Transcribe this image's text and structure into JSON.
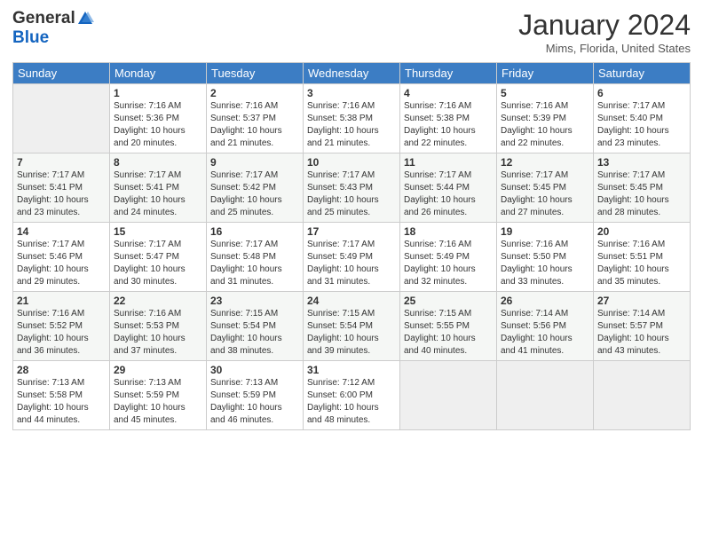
{
  "header": {
    "logo_general": "General",
    "logo_blue": "Blue",
    "month_title": "January 2024",
    "location": "Mims, Florida, United States"
  },
  "weekdays": [
    "Sunday",
    "Monday",
    "Tuesday",
    "Wednesday",
    "Thursday",
    "Friday",
    "Saturday"
  ],
  "weeks": [
    [
      {
        "day": "",
        "empty": true
      },
      {
        "day": "1",
        "sunrise": "Sunrise: 7:16 AM",
        "sunset": "Sunset: 5:36 PM",
        "daylight": "Daylight: 10 hours and 20 minutes."
      },
      {
        "day": "2",
        "sunrise": "Sunrise: 7:16 AM",
        "sunset": "Sunset: 5:37 PM",
        "daylight": "Daylight: 10 hours and 21 minutes."
      },
      {
        "day": "3",
        "sunrise": "Sunrise: 7:16 AM",
        "sunset": "Sunset: 5:38 PM",
        "daylight": "Daylight: 10 hours and 21 minutes."
      },
      {
        "day": "4",
        "sunrise": "Sunrise: 7:16 AM",
        "sunset": "Sunset: 5:38 PM",
        "daylight": "Daylight: 10 hours and 22 minutes."
      },
      {
        "day": "5",
        "sunrise": "Sunrise: 7:16 AM",
        "sunset": "Sunset: 5:39 PM",
        "daylight": "Daylight: 10 hours and 22 minutes."
      },
      {
        "day": "6",
        "sunrise": "Sunrise: 7:17 AM",
        "sunset": "Sunset: 5:40 PM",
        "daylight": "Daylight: 10 hours and 23 minutes."
      }
    ],
    [
      {
        "day": "7",
        "sunrise": "Sunrise: 7:17 AM",
        "sunset": "Sunset: 5:41 PM",
        "daylight": "Daylight: 10 hours and 23 minutes."
      },
      {
        "day": "8",
        "sunrise": "Sunrise: 7:17 AM",
        "sunset": "Sunset: 5:41 PM",
        "daylight": "Daylight: 10 hours and 24 minutes."
      },
      {
        "day": "9",
        "sunrise": "Sunrise: 7:17 AM",
        "sunset": "Sunset: 5:42 PM",
        "daylight": "Daylight: 10 hours and 25 minutes."
      },
      {
        "day": "10",
        "sunrise": "Sunrise: 7:17 AM",
        "sunset": "Sunset: 5:43 PM",
        "daylight": "Daylight: 10 hours and 25 minutes."
      },
      {
        "day": "11",
        "sunrise": "Sunrise: 7:17 AM",
        "sunset": "Sunset: 5:44 PM",
        "daylight": "Daylight: 10 hours and 26 minutes."
      },
      {
        "day": "12",
        "sunrise": "Sunrise: 7:17 AM",
        "sunset": "Sunset: 5:45 PM",
        "daylight": "Daylight: 10 hours and 27 minutes."
      },
      {
        "day": "13",
        "sunrise": "Sunrise: 7:17 AM",
        "sunset": "Sunset: 5:45 PM",
        "daylight": "Daylight: 10 hours and 28 minutes."
      }
    ],
    [
      {
        "day": "14",
        "sunrise": "Sunrise: 7:17 AM",
        "sunset": "Sunset: 5:46 PM",
        "daylight": "Daylight: 10 hours and 29 minutes."
      },
      {
        "day": "15",
        "sunrise": "Sunrise: 7:17 AM",
        "sunset": "Sunset: 5:47 PM",
        "daylight": "Daylight: 10 hours and 30 minutes."
      },
      {
        "day": "16",
        "sunrise": "Sunrise: 7:17 AM",
        "sunset": "Sunset: 5:48 PM",
        "daylight": "Daylight: 10 hours and 31 minutes."
      },
      {
        "day": "17",
        "sunrise": "Sunrise: 7:17 AM",
        "sunset": "Sunset: 5:49 PM",
        "daylight": "Daylight: 10 hours and 31 minutes."
      },
      {
        "day": "18",
        "sunrise": "Sunrise: 7:16 AM",
        "sunset": "Sunset: 5:49 PM",
        "daylight": "Daylight: 10 hours and 32 minutes."
      },
      {
        "day": "19",
        "sunrise": "Sunrise: 7:16 AM",
        "sunset": "Sunset: 5:50 PM",
        "daylight": "Daylight: 10 hours and 33 minutes."
      },
      {
        "day": "20",
        "sunrise": "Sunrise: 7:16 AM",
        "sunset": "Sunset: 5:51 PM",
        "daylight": "Daylight: 10 hours and 35 minutes."
      }
    ],
    [
      {
        "day": "21",
        "sunrise": "Sunrise: 7:16 AM",
        "sunset": "Sunset: 5:52 PM",
        "daylight": "Daylight: 10 hours and 36 minutes."
      },
      {
        "day": "22",
        "sunrise": "Sunrise: 7:16 AM",
        "sunset": "Sunset: 5:53 PM",
        "daylight": "Daylight: 10 hours and 37 minutes."
      },
      {
        "day": "23",
        "sunrise": "Sunrise: 7:15 AM",
        "sunset": "Sunset: 5:54 PM",
        "daylight": "Daylight: 10 hours and 38 minutes."
      },
      {
        "day": "24",
        "sunrise": "Sunrise: 7:15 AM",
        "sunset": "Sunset: 5:54 PM",
        "daylight": "Daylight: 10 hours and 39 minutes."
      },
      {
        "day": "25",
        "sunrise": "Sunrise: 7:15 AM",
        "sunset": "Sunset: 5:55 PM",
        "daylight": "Daylight: 10 hours and 40 minutes."
      },
      {
        "day": "26",
        "sunrise": "Sunrise: 7:14 AM",
        "sunset": "Sunset: 5:56 PM",
        "daylight": "Daylight: 10 hours and 41 minutes."
      },
      {
        "day": "27",
        "sunrise": "Sunrise: 7:14 AM",
        "sunset": "Sunset: 5:57 PM",
        "daylight": "Daylight: 10 hours and 43 minutes."
      }
    ],
    [
      {
        "day": "28",
        "sunrise": "Sunrise: 7:13 AM",
        "sunset": "Sunset: 5:58 PM",
        "daylight": "Daylight: 10 hours and 44 minutes."
      },
      {
        "day": "29",
        "sunrise": "Sunrise: 7:13 AM",
        "sunset": "Sunset: 5:59 PM",
        "daylight": "Daylight: 10 hours and 45 minutes."
      },
      {
        "day": "30",
        "sunrise": "Sunrise: 7:13 AM",
        "sunset": "Sunset: 5:59 PM",
        "daylight": "Daylight: 10 hours and 46 minutes."
      },
      {
        "day": "31",
        "sunrise": "Sunrise: 7:12 AM",
        "sunset": "Sunset: 6:00 PM",
        "daylight": "Daylight: 10 hours and 48 minutes."
      },
      {
        "day": "",
        "empty": true
      },
      {
        "day": "",
        "empty": true
      },
      {
        "day": "",
        "empty": true
      }
    ]
  ]
}
